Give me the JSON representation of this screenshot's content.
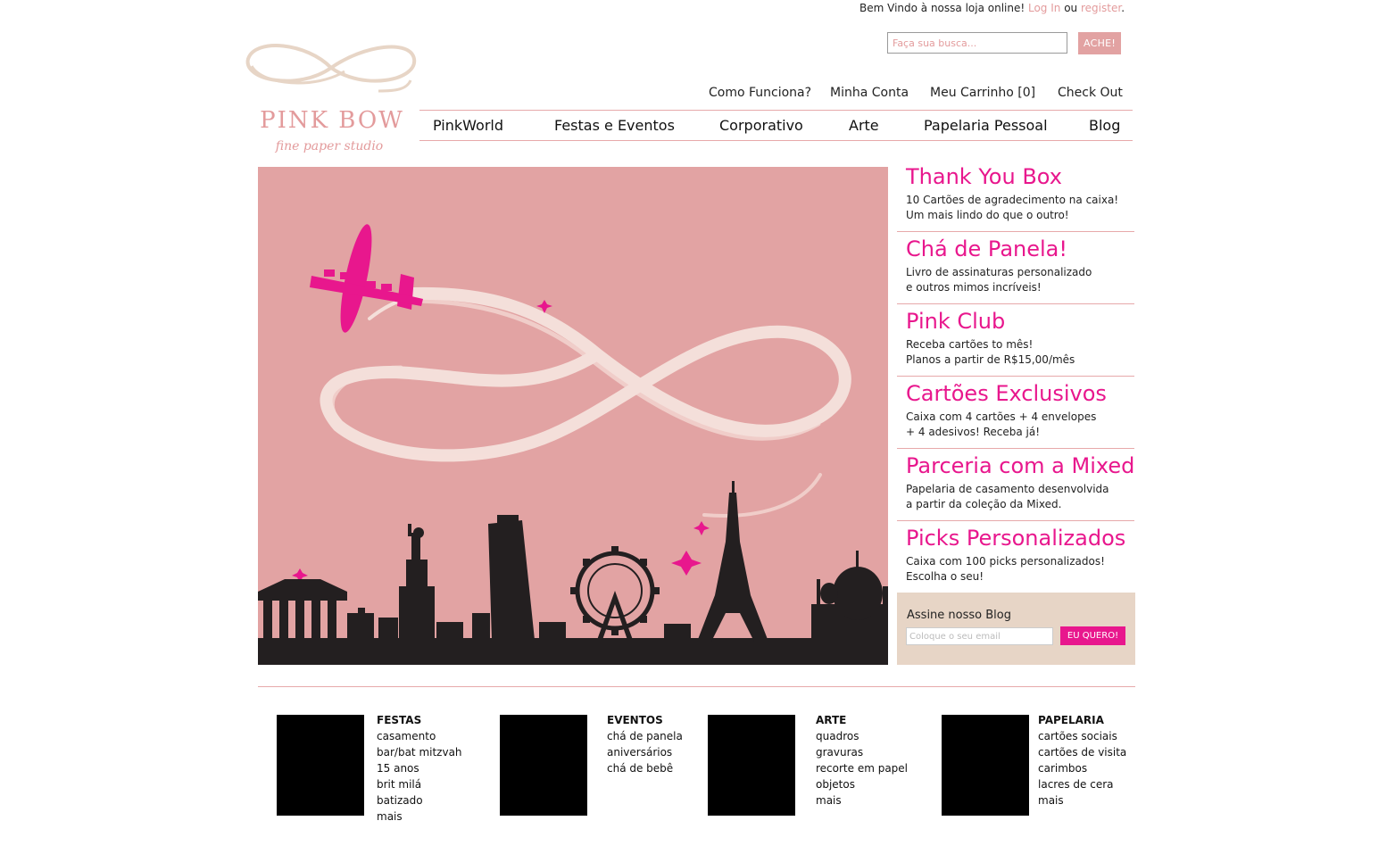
{
  "header": {
    "welcome_text": "Bem Vindo à nossa loja online!",
    "login_label": "Log In",
    "or_text": "ou",
    "register_label": "register",
    "period": "."
  },
  "search": {
    "placeholder": "Faça sua busca...",
    "button_label": "ACHE!"
  },
  "logo": {
    "title": "PINK BOW",
    "subtitle": "fine paper studio"
  },
  "subnav": [
    "Como Funciona?",
    "Minha Conta",
    "Meu Carrinho [0]",
    "Check Out"
  ],
  "mainnav": [
    "PinkWorld",
    "Festas e Eventos",
    "Corporativo",
    "Arte",
    "Papelaria Pessoal",
    "Blog"
  ],
  "promos": [
    {
      "title": "Thank You Box",
      "line1": "10 Cartões de agradecimento na caixa!",
      "line2": "Um mais lindo do que o outro!"
    },
    {
      "title": "Chá de Panela!",
      "line1": "Livro de assinaturas personalizado",
      "line2": "e outros mimos incríveis!"
    },
    {
      "title": "Pink Club",
      "line1": "Receba cartões to mês!",
      "line2": "Planos a partir de R$15,00/mês"
    },
    {
      "title": "Cartões Exclusivos",
      "line1": "Caixa com 4 cartões + 4 envelopes",
      "line2": "+ 4 adesivos! Receba já!"
    },
    {
      "title": "Parceria com a Mixed",
      "line1": "Papelaria de casamento desenvolvida",
      "line2": "a partir da coleção da Mixed."
    },
    {
      "title": "Picks Personalizados",
      "line1": "Caixa com 100 picks personalizados!",
      "line2": "Escolha o seu!"
    }
  ],
  "blog": {
    "title": "Assine nosso Blog",
    "placeholder": "Coloque o seu email",
    "button_label": "EU QUERO!"
  },
  "categories": [
    {
      "title": "FESTAS",
      "items": [
        "casamento",
        "bar/bat mitzvah",
        "15 anos",
        "brit milá",
        "batizado",
        "mais"
      ]
    },
    {
      "title": "EVENTOS",
      "items": [
        "chá de panela",
        "aniversários",
        "chá de bebê"
      ]
    },
    {
      "title": "ARTE",
      "items": [
        "quadros",
        "gravuras",
        "recorte em papel",
        "objetos",
        "mais"
      ]
    },
    {
      "title": "PAPELARIA",
      "items": [
        "cartões sociais",
        "cartões de visita",
        "carimbos",
        "lacres de cera",
        "mais"
      ]
    }
  ],
  "colors": {
    "accent_pink": "#e8178d",
    "soft_pink": "#e39b9c",
    "hero_bg": "#e2a3a3",
    "blog_bg": "#e7d5c6",
    "skyline": "#231f20"
  },
  "icons": [
    "infinity-bow-logo",
    "airplane-icon",
    "sparkle-icon"
  ]
}
